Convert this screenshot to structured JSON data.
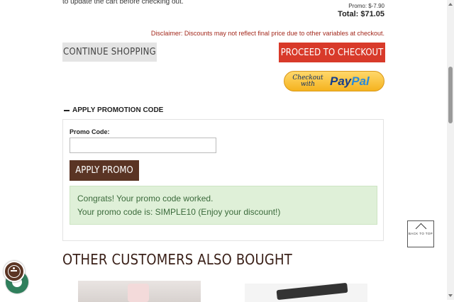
{
  "cart": {
    "update_note": "to update the cart before checking out.",
    "promo_line": "Promo: $-7.90",
    "total_line": "Total: $71.05",
    "disclaimer": "Disclaimer: Discounts may not reflect final price due to other variables at checkout."
  },
  "actions": {
    "continue_label": "Continue Shopping",
    "checkout_label": "Proceed to Checkout",
    "paypal": {
      "checkout_text": "Checkout with",
      "logo_pay": "Pay",
      "logo_pal": "Pal"
    }
  },
  "promotion": {
    "toggle_label": "APPLY PROMOTION CODE",
    "field_label": "Promo Code:",
    "input_value": "",
    "apply_label": "Apply Promo",
    "success_line1": "Congrats! Your promo code worked.",
    "success_line2": "Your promo code is: SIMPLE10 (Enjoy your discount!)"
  },
  "also_bought": {
    "heading": "Other Customers Also Bought"
  },
  "back_to_top": {
    "label": "BACK TO TOP"
  },
  "colors": {
    "checkout_red": "#d83a2a",
    "brand_brown": "#5a3424",
    "success_bg": "#dff0d8",
    "disclaimer_red": "#a3281c"
  }
}
